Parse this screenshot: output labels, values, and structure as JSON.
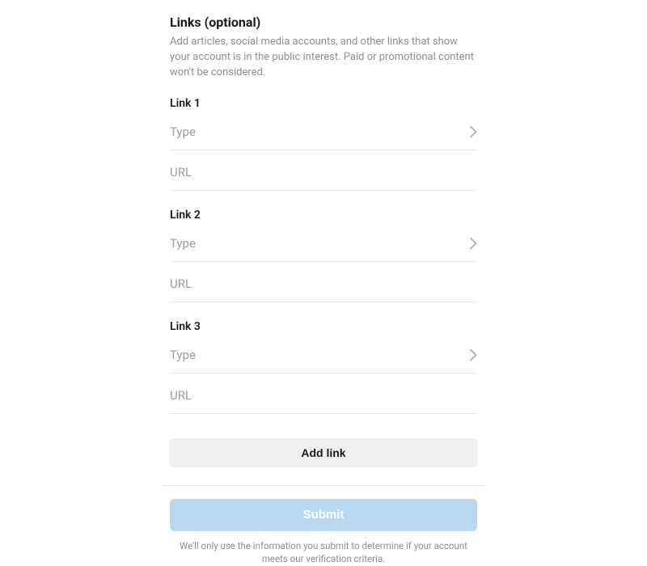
{
  "section": {
    "title": "Links (optional)",
    "description": "Add articles, social media accounts, and other links that show your account is in the public interest. Paid or promotional content won't be considered."
  },
  "links": [
    {
      "label": "Link 1",
      "type_placeholder": "Type",
      "url_placeholder": "URL"
    },
    {
      "label": "Link 2",
      "type_placeholder": "Type",
      "url_placeholder": "URL"
    },
    {
      "label": "Link 3",
      "type_placeholder": "Type",
      "url_placeholder": "URL"
    }
  ],
  "add_link_label": "Add link",
  "submit_label": "Submit",
  "footer_note": "We'll only use the information you submit to determine if your account meets our verification criteria."
}
